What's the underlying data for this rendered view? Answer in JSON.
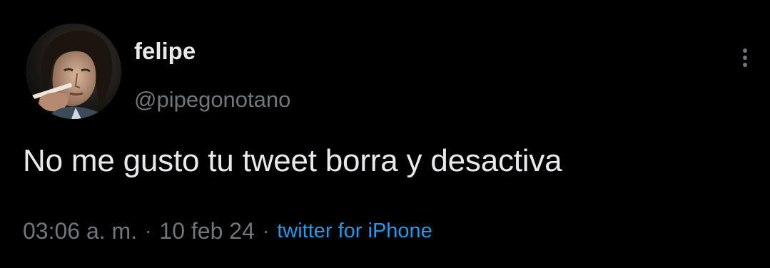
{
  "tweet": {
    "author": {
      "display_name": "felipe",
      "handle": "@pipegonotano"
    },
    "text": "No me gusto tu tweet borra y desactiva",
    "time": "03:06 a. m.",
    "separator": "·",
    "date": "10 feb 24",
    "source": "twitter for iPhone",
    "more_icon": "more-vertical-icon"
  },
  "colors": {
    "background": "#000000",
    "primary_text": "#e7e9ea",
    "secondary_text": "#71767b",
    "link": "#1d9bf0"
  }
}
